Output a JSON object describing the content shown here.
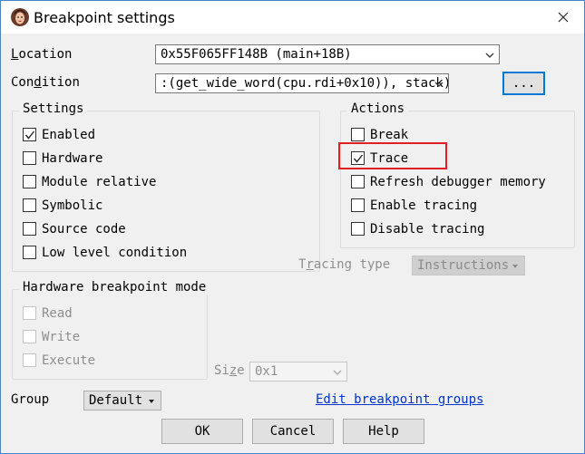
{
  "window": {
    "title": "Breakpoint settings"
  },
  "location": {
    "label": "Location",
    "value": "0x55F065FF148B (main+18B)"
  },
  "condition": {
    "label": "Condition",
    "value": ":(get_wide_word(cpu.rdi+0x10)), stack)",
    "browse_label": "..."
  },
  "settings": {
    "title": "Settings",
    "items": [
      {
        "label": "Enabled",
        "checked": true
      },
      {
        "label": "Hardware",
        "checked": false
      },
      {
        "label": "Module relative",
        "checked": false
      },
      {
        "label": "Symbolic",
        "checked": false
      },
      {
        "label": "Source code",
        "checked": false
      },
      {
        "label": "Low level condition",
        "checked": false
      }
    ]
  },
  "actions": {
    "title": "Actions",
    "items": [
      {
        "label": "Break",
        "checked": false
      },
      {
        "label": "Trace",
        "checked": true
      },
      {
        "label": "Refresh debugger memory",
        "checked": false
      },
      {
        "label": "Enable tracing",
        "checked": false
      },
      {
        "label": "Disable tracing",
        "checked": false
      }
    ],
    "highlight_color": "#e31f26"
  },
  "tracing": {
    "label": "Tracing type",
    "value": "Instructions"
  },
  "hw_mode": {
    "title": "Hardware breakpoint mode",
    "items": [
      {
        "label": "Read"
      },
      {
        "label": "Write"
      },
      {
        "label": "Execute"
      }
    ],
    "size_label": "Size",
    "size_value": "0x1"
  },
  "group": {
    "label": "Group",
    "value": "Default",
    "edit_link": "Edit breakpoint groups"
  },
  "buttons": {
    "ok": "OK",
    "cancel": "Cancel",
    "help": "Help"
  },
  "colors": {
    "accent": "#0078d7",
    "link": "#0033cc",
    "window_border": "#4a84c4"
  }
}
